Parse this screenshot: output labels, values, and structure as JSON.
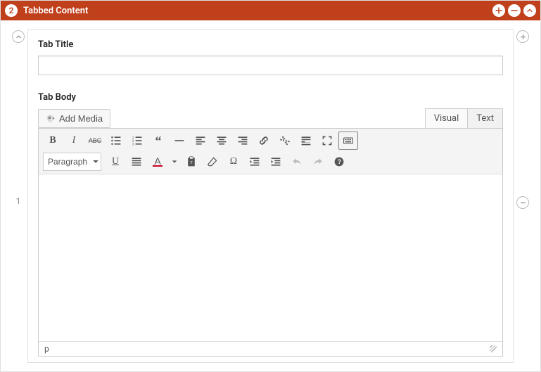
{
  "header": {
    "badge": "2",
    "title": "Tabbed Content"
  },
  "row_number": "1",
  "fields": {
    "tab_title_label": "Tab Title",
    "tab_title_value": "",
    "tab_body_label": "Tab Body"
  },
  "editor": {
    "add_media_label": "Add Media",
    "tabs": {
      "visual": "Visual",
      "text": "Text"
    },
    "format_select": "Paragraph",
    "status_path": "p"
  }
}
